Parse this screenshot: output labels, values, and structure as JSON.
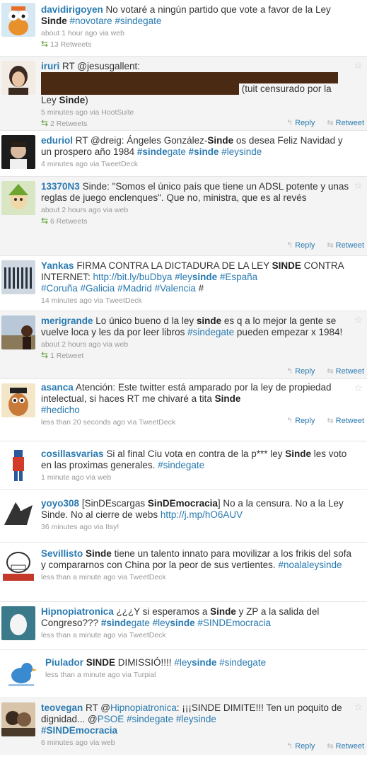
{
  "icons": {
    "retweet": "retweet-icon",
    "reply": "reply-icon",
    "star": "star-icon"
  },
  "tweets": [
    {
      "user": "davidirigoyen",
      "t1": "No votaré a ningún partido que vote a favor de la Ley ",
      "t2": "Sinde",
      "t3": " ",
      "tag1": "#novotare",
      "tag2": " #sindegate",
      "meta": "about 1 hour ago via web",
      "rt": "13 Retweets"
    },
    {
      "user": "iruri",
      "t1": "RT @jesusgallent:",
      "t2": "(tuit censurado por la",
      "t3": "Ley ",
      "t4": "Sinde",
      ")": ")",
      "meta": "5 minutes ago via HootSuite",
      "rt": "2 Retweets",
      "reply": "Reply",
      "retweet": "Retweet"
    },
    {
      "user": "eduriol",
      "t1": "RT @dreig: Ángeles González-",
      "t2": "Sinde",
      "t3": " os desea Feliz Navidad y un prospero año 1984 ",
      "tag1": "#sinde",
      "tag1b": "gate",
      "tag2": " #sinde",
      "tag3": " #leysinde",
      "meta": "4 minutes ago via TweetDeck"
    },
    {
      "user": "13370N3",
      "t1": "Sinde: \"Somos el único país que tiene un ADSL potente y unas reglas de juego enclenques\". Que no, ministra, que es al revés",
      "meta": "about 2 hours ago via web",
      "rt": "6 Retweets",
      "reply": "Reply",
      "retweet": "Retweet"
    },
    {
      "user": "Yankas",
      "t1": "FIRMA CONTRA LA DICTADURA DE LA LEY ",
      "t2": "SINDE",
      "t3": " CONTRA INTERNET: ",
      "link": "http://bit.ly/buDbya",
      "tag1": " #ley",
      "tag1b": "sinde",
      "tag2": " #España",
      "tag3": "#Coruña #Galicia #Madrid #Valencia",
      "t4": " #",
      "meta": "14 minutes ago via TweetDeck"
    },
    {
      "user": "merigrande",
      "t1": "Lo único bueno d la ley ",
      "t2": "sinde",
      "t3": " es q a lo mejor la gente se vuelve loca y les da por leer libros ",
      "tag1": "#sindegate",
      "t4": " pueden empezar x 1984!",
      "meta": "about 2 hours ago via web",
      "rt": "1 Retweet",
      "reply": "Reply",
      "retweet": "Retweet"
    },
    {
      "user": "asanca",
      "t1": "Atención: Este twitter está amparado por la ley de propiedad intelectual, si haces RT me chivaré a tita ",
      "t2": "Sinde",
      "tag1": "#hedicho",
      "meta": "less than 20 seconds ago via TweetDeck",
      "reply": "Reply",
      "retweet": "Retweet"
    },
    {
      "user": "cosillasvarias",
      "t1": "Si al final Ciu vota en contra de la p*** ley ",
      "t2": "Sinde",
      "t3": " les voto en las proximas generales. ",
      "tag1": "#sindegate",
      "meta": "1 minute ago via web"
    },
    {
      "user": "yoyo308",
      "t1": "[SinDEscargas ",
      "t2": "SinDEmocracia",
      "t3": "] No a la censura. No a la Ley Sinde. No al cierre de webs ",
      "link": "http://j.mp/hO6AUV",
      "meta": "36 minutes ago via Itsy!"
    },
    {
      "user": "Sevillisto",
      "t1": " ",
      "t2": "Sinde",
      "t3": " tiene un talento innato para movilizar a los frikis del sofa y compararnos con China por la peor de sus vertientes. ",
      "tag1": "#noalaleysinde",
      "meta": "less than a minute ago via TweetDeck"
    },
    {
      "user": "Hipnopiatronica",
      "t1": "¿¿¿Y si esperamos a ",
      "t2": "Sinde",
      "t3": " y ZP a la salida del Congreso??? ",
      "tag1": "#sinde",
      "tag1b": "gate",
      "tag2": " #ley",
      "tag2b": "sinde",
      "tag3": " #SINDEmocracia",
      "meta": "less than a minute ago via TweetDeck"
    },
    {
      "user": "Piulador",
      "t1": " ",
      "t2": "SINDE",
      "t3": " DIMISSIÓ!!!! ",
      "tag1": "#ley",
      "tag1b": "sinde",
      "tag2": " #sindegate",
      "meta": "less than a minute ago via Turpial"
    },
    {
      "user": "teovegan",
      "t1": "RT @",
      "link": "Hipnopiatronica",
      "t2": ": ¡¡¡SINDE DIMITE!!! Ten un poquito de dignidad... @",
      "link2": "PSOE",
      "tag1": " #sindegate #leysinde",
      "tag2": "#SINDEmocracia",
      "meta": "6 minutes ago via web",
      "reply": "Reply",
      "retweet": "Retweet"
    }
  ]
}
